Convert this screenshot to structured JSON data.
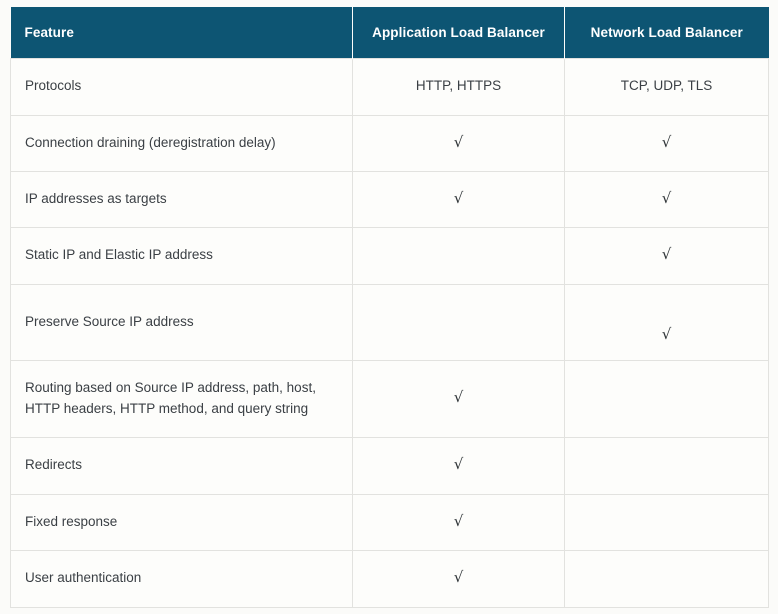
{
  "table": {
    "columns": [
      {
        "key": "feature",
        "label": "Feature",
        "align": "left"
      },
      {
        "key": "alb",
        "label": "Application Load Balancer",
        "align": "center"
      },
      {
        "key": "nlb",
        "label": "Network Load Balancer",
        "align": "center"
      }
    ],
    "header_background": "#0d5573",
    "header_text_color": "#ffffff",
    "border_color": "#e2e2df",
    "cell_background": "#fdfdfb",
    "page_background": "#fbfbf9",
    "check_glyph": "√",
    "rows": [
      {
        "feature": "Protocols",
        "alb": "HTTP, HTTPS",
        "nlb": "TCP, UDP, TLS"
      },
      {
        "feature": "Connection draining (deregistration delay)",
        "alb": "√",
        "nlb": "√"
      },
      {
        "feature": "IP addresses as targets",
        "alb": "√",
        "nlb": "√"
      },
      {
        "feature": "Static IP and Elastic IP address",
        "alb": "",
        "nlb": "√"
      },
      {
        "feature": "Preserve Source IP address",
        "alb": "",
        "nlb": "√"
      },
      {
        "feature": "Routing based on Source IP address, path, host, HTTP headers, HTTP method, and query string",
        "alb": "√",
        "nlb": ""
      },
      {
        "feature": "Redirects",
        "alb": "√",
        "nlb": ""
      },
      {
        "feature": "Fixed response",
        "alb": "√",
        "nlb": ""
      },
      {
        "feature": "User authentication",
        "alb": "√",
        "nlb": ""
      }
    ]
  }
}
